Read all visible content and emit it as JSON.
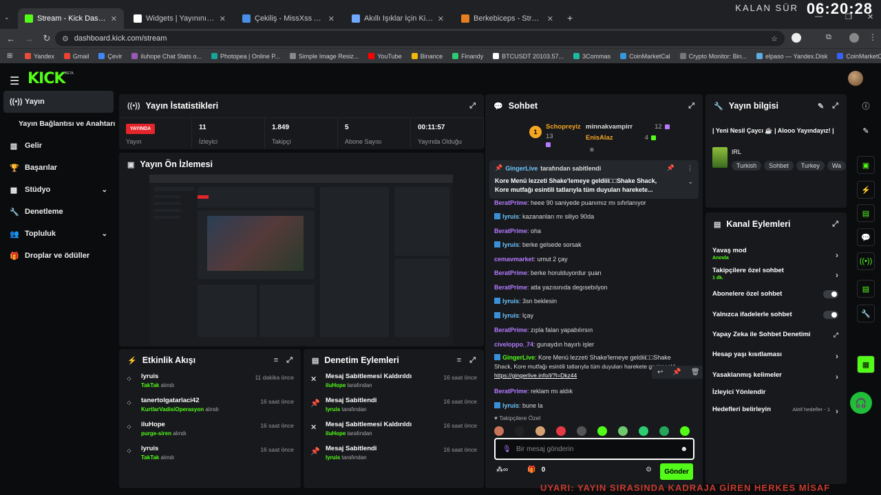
{
  "browser": {
    "tabs": [
      {
        "title": "Stream - Kick Dashboard",
        "color": "#53fc18"
      },
      {
        "title": "Widgets | Yayınını güçlendirmek",
        "color": "#ffffff"
      },
      {
        "title": "Çekiliş - MissXss AI Bot System",
        "color": "#4a8fe7"
      },
      {
        "title": "Akıllı Işıklar İçin Kick Chat Kontr",
        "color": "#6fa8ff"
      },
      {
        "title": "Berkebiceps - Stream Overla",
        "color": "#e67e22"
      }
    ],
    "url": "dashboard.kick.com/stream",
    "bookmarks": [
      {
        "label": "Yandex",
        "color": "#e74c3c"
      },
      {
        "label": "Gmail",
        "color": "#ea4335"
      },
      {
        "label": "Çevir",
        "color": "#4285f4"
      },
      {
        "label": "iluhope Chat Stats o...",
        "color": "#9b59b6"
      },
      {
        "label": "Photopea | Online P...",
        "color": "#18a497"
      },
      {
        "label": "Simple Image Resiz...",
        "color": "#888888"
      },
      {
        "label": "YouTube",
        "color": "#ff0000"
      },
      {
        "label": "Binance",
        "color": "#f0b90b"
      },
      {
        "label": "Finandy",
        "color": "#2ecc71"
      },
      {
        "label": "BTCUSDT 20103.57...",
        "color": "#ffffff"
      },
      {
        "label": "3Commas",
        "color": "#1abc9c"
      },
      {
        "label": "CoinMarketCal",
        "color": "#3498db"
      },
      {
        "label": "Crypto Monitor: Bin...",
        "color": "#777777"
      },
      {
        "label": "elpaso — Yandex.Disk",
        "color": "#5dade2"
      },
      {
        "label": "CoinMarketCAP",
        "color": "#3861fb"
      }
    ],
    "overlay_label": "KALAN SÜR",
    "overlay_clock": "06:20:28"
  },
  "logo": "KICK",
  "logo_badge": "BETA",
  "sidebar": [
    {
      "label": "Yayın",
      "active": true,
      "icon": "broadcast-icon",
      "glyph": "((•))"
    },
    {
      "label": "Yayın Bağlantısı ve Anahtarı",
      "indent": true
    },
    {
      "label": "Gelir",
      "icon": "chart-icon",
      "glyph": "▥"
    },
    {
      "label": "Başarılar",
      "icon": "trophy-icon",
      "glyph": "🏆"
    },
    {
      "label": "Stüdyo",
      "icon": "grid-icon",
      "glyph": "▦",
      "chevron": true
    },
    {
      "label": "Denetleme",
      "icon": "wrench-icon",
      "glyph": "🔧"
    },
    {
      "label": "Topluluk",
      "icon": "people-icon",
      "glyph": "👥",
      "chevron": true
    },
    {
      "label": "Droplar ve ödüller",
      "icon": "gift-icon",
      "glyph": "🎁"
    }
  ],
  "stats": {
    "title": "Yayın İstatistikleri",
    "live_badge": "YAYINDA",
    "items": [
      {
        "value": "",
        "label": "Yayın"
      },
      {
        "value": "11",
        "label": "İzleyici"
      },
      {
        "value": "1.849",
        "label": "Takipçi"
      },
      {
        "value": "5",
        "label": "Abone Sayısı"
      },
      {
        "value": "00:11:57",
        "label": "Yayında Olduğu"
      }
    ]
  },
  "preview": {
    "title": "Yayın Ön İzlemesi"
  },
  "activity": {
    "title": "Etkinlik Akışı",
    "items": [
      {
        "name": "lyruis",
        "item": "TakTak",
        "suffix": "alındı",
        "time": "11 dakika önce"
      },
      {
        "name": "tanertolgatarlaci42",
        "item": "KurtlarVadisiOperasyon",
        "suffix": "alındı",
        "time": "16 saat önce"
      },
      {
        "name": "iluHope",
        "item": "purge-siren",
        "suffix": "alındı",
        "time": "16 saat önce"
      },
      {
        "name": "lyruis",
        "item": "TakTak",
        "suffix": "alındı",
        "time": "16 saat önce"
      }
    ]
  },
  "moderation": {
    "title": "Denetim Eylemleri",
    "items": [
      {
        "action": "Mesaj Sabitlemesi Kaldırıldı",
        "by": "iluHope",
        "suffix": "tarafından",
        "time": "16 saat önce",
        "icon": "unpin-icon"
      },
      {
        "action": "Mesaj Sabitlendi",
        "by": "lyruis",
        "suffix": "tarafından",
        "time": "16 saat önce",
        "icon": "pin-icon"
      },
      {
        "action": "Mesaj Sabitlemesi Kaldırıldı",
        "by": "iluHope",
        "suffix": "tarafından",
        "time": "16 saat önce",
        "icon": "unpin-icon"
      },
      {
        "action": "Mesaj Sabitlendi",
        "by": "lyruis",
        "suffix": "tarafından",
        "time": "16 saat önce",
        "icon": "pin-icon"
      }
    ]
  },
  "chat": {
    "title": "Sohbet",
    "leaders": [
      {
        "name": "Schopreyiz",
        "count": "13"
      },
      {
        "name": "minnakvampirr",
        "count": "12"
      },
      {
        "name": "EnisAlaz",
        "count": "4"
      }
    ],
    "pinned": {
      "by": "GingerLive",
      "by_suffix": "tarafından sabitlendi",
      "text1": "Kore Menü lezzeti Shake'lemeye geldiii□□Shake Shack,",
      "text2": "Kore mutfağı esintili tatlarıyla tüm duyuları harekete..."
    },
    "messages": [
      {
        "user": "BeratPrime",
        "color": "#b57bff",
        "text": "heee 90 saniyede puanımız mı sıfırlanıyor"
      },
      {
        "user": "lyruis",
        "color": "#6ec6ff",
        "text": "kazananları mı siliyo 90da"
      },
      {
        "user": "BeratPrime",
        "color": "#b57bff",
        "text": "oha"
      },
      {
        "user": "lyruis",
        "color": "#6ec6ff",
        "text": "berke gelsede sorsak"
      },
      {
        "user": "cemavmarket",
        "color": "#b57bff",
        "text": "umut 2 çay"
      },
      {
        "user": "BeratPrime",
        "color": "#b57bff",
        "text": "berke horulduyordur şuan"
      },
      {
        "user": "BeratPrime",
        "color": "#b57bff",
        "text": "atla yazısınıda degısebılyon"
      },
      {
        "user": "lyruis",
        "color": "#6ec6ff",
        "text": "3sn beklesin"
      },
      {
        "user": "lyruis",
        "color": "#6ec6ff",
        "text": "lçay"
      },
      {
        "user": "BeratPrime",
        "color": "#b57bff",
        "text": "zıpla falan yapabılırsın"
      },
      {
        "user": "civeloppo_74",
        "color": "#b57bff",
        "text": "gunaydın hayırlı işler"
      },
      {
        "user": "GingerLive",
        "color": "#53fc18",
        "text": "Kore Menü lezzeti Shake'lemeye geldiii□□Shake"
      },
      {
        "user": "",
        "color": "#ddd",
        "text": "Shack, Kore mutfağı esintili tatlarıyla tüm duyuları harekete geçirecek!"
      },
      {
        "user": "",
        "color": "#ddd",
        "text": "https://gingerlive.info/l/?l=Dkz44"
      },
      {
        "user": "BeratPrime",
        "color": "#b57bff",
        "text": "reklam mı aldık"
      },
      {
        "user": "lyruis",
        "color": "#6ec6ff",
        "text": "bune la"
      }
    ],
    "followers_only": "Takipçilere Özel",
    "input_placeholder": "Bir mesaj gönderin",
    "points": "0",
    "send_label": "Gönder"
  },
  "info": {
    "title": "Yayın bilgisi",
    "stream_title": "| Yeni Nesil Çaycı ☕ | Alooo Yayındayız! |",
    "category": "IRL",
    "tags": [
      "Turkish",
      "Sohbet",
      "Turkey",
      "Wa"
    ]
  },
  "actions": {
    "title": "Kanal Eylemleri",
    "items": [
      {
        "label": "Yavaş mod",
        "sub": "Anında",
        "control": "arrow"
      },
      {
        "label": "Takipçilere özel sohbet",
        "sub": "1 dk.",
        "control": "arrow"
      },
      {
        "label": "Abonelere özel sohbet",
        "sub": "",
        "control": "toggle"
      },
      {
        "label": "Yalnızca ifadelerle sohbet",
        "sub": "",
        "control": "toggle"
      },
      {
        "label": "Yapay Zeka ile Sohbet Denetimi",
        "sub": "",
        "control": "external"
      },
      {
        "label": "Hesap yaşı kısıtlaması",
        "sub": "",
        "control": "arrow"
      },
      {
        "label": "Yasaklanmış kelimeler",
        "sub": "",
        "control": "arrow"
      },
      {
        "label": "İzleyici Yönlendir",
        "sub": "",
        "control": "none"
      },
      {
        "label": "Hedefleri belirleyin",
        "sub": "",
        "control": "arrow",
        "extra": "Aktif hedefler - 1"
      }
    ]
  },
  "ticker": "UYARI: YAYIN SIRASINDA KADRAJA GİREN HERKES MİSAF"
}
